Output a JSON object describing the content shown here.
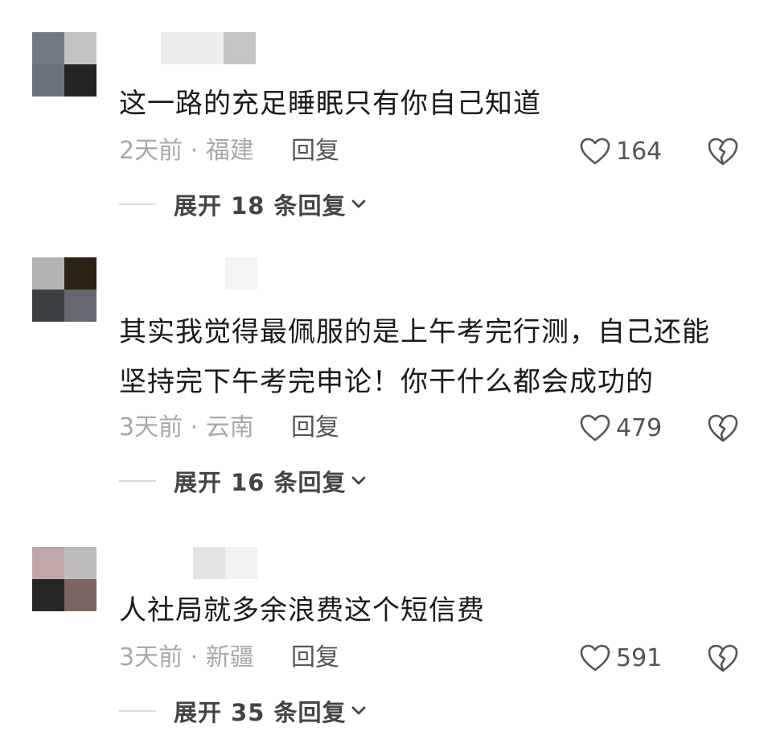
{
  "comments": [
    {
      "avatar_colors": [
        "#6f7a80",
        "#c2c4c4",
        "#6a7378",
        "#232323"
      ],
      "name_colors": [
        "#eeeeef",
        "#c6c6c9"
      ],
      "text": "这一路的充足睡眠只有你自己知道",
      "time_location": "2天前 · 福建",
      "reply_label": "回复",
      "likes": "164",
      "expand_label": "展开 18 条回复"
    },
    {
      "avatar_colors": [
        "#b4b3b1",
        "#2a2315",
        "#3c3f42",
        "#666870"
      ],
      "name_colors": [
        "#f3f3f3"
      ],
      "text_lines": [
        "其实我觉得最佩服的是上午考完行测，自己还能",
        "坚持完下午考完申论！你干什么都会成功的"
      ],
      "time_location": "3天前 · 云南",
      "reply_label": "回复",
      "likes": "479",
      "expand_label": "展开 16 条回复"
    },
    {
      "avatar_colors": [
        "#c0a8a8",
        "#bdbcbb",
        "#272826",
        "#7a6660"
      ],
      "name_colors": [
        "#e4e4e4",
        "#f1f1f1"
      ],
      "text": "人社局就多余浪费这个短信费",
      "time_location": "3天前 · 新疆",
      "reply_label": "回复",
      "likes": "591",
      "expand_label": "展开 35 条回复"
    }
  ],
  "icons": {
    "like": "heart-outline-icon",
    "dislike": "broken-heart-icon",
    "expand": "chevron-down-icon"
  }
}
